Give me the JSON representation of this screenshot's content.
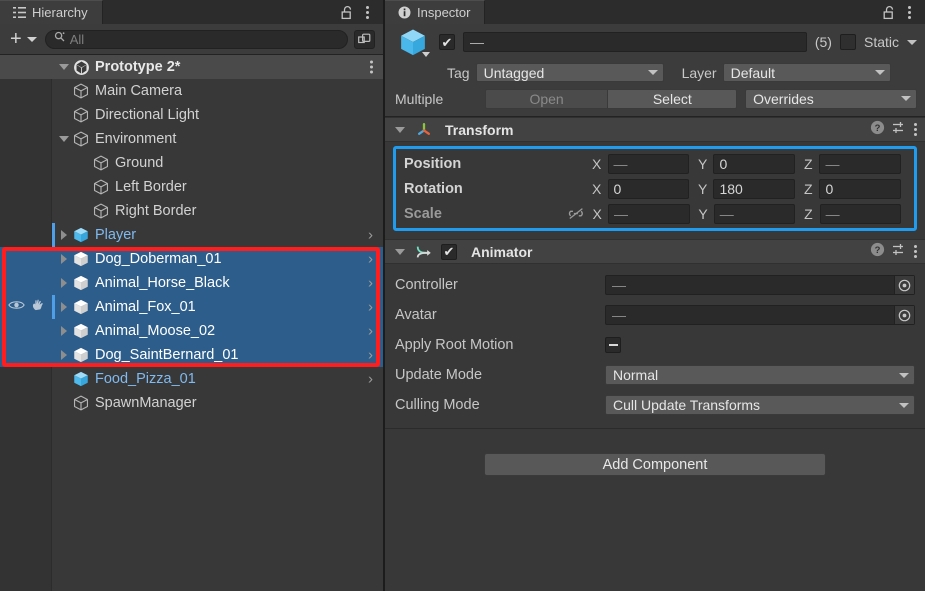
{
  "hierarchy": {
    "tab_label": "Hierarchy",
    "tab_icon": "hierarchy-icon",
    "lock_icon": "lock-open-icon",
    "menu_icon": "kebab-menu-icon",
    "toolbar": {
      "add_label": "+",
      "add_icon": "plus-icon",
      "search_placeholder": "All",
      "search_icon": "search-icon",
      "expand_icon": "external-window-icon"
    },
    "scene": {
      "name": "Prototype 2*",
      "icon": "unity-scene-icon",
      "expanded": true
    },
    "items": [
      {
        "label": "Main Camera",
        "depth": 2,
        "icon": "cube-gray-icon",
        "foldout": "none",
        "selected": false,
        "prefab": false,
        "chevron": false
      },
      {
        "label": "Directional Light",
        "depth": 2,
        "icon": "cube-gray-icon",
        "foldout": "none",
        "selected": false,
        "prefab": false,
        "chevron": false
      },
      {
        "label": "Environment",
        "depth": 2,
        "icon": "cube-gray-icon",
        "foldout": "expanded",
        "selected": false,
        "prefab": false,
        "chevron": false
      },
      {
        "label": "Ground",
        "depth": 3,
        "icon": "cube-gray-icon",
        "foldout": "none",
        "selected": false,
        "prefab": false,
        "chevron": false
      },
      {
        "label": "Left Border",
        "depth": 3,
        "icon": "cube-gray-icon",
        "foldout": "none",
        "selected": false,
        "prefab": false,
        "chevron": false
      },
      {
        "label": "Right Border",
        "depth": 3,
        "icon": "cube-gray-icon",
        "foldout": "none",
        "selected": false,
        "prefab": false,
        "chevron": false
      },
      {
        "label": "Player",
        "depth": 2,
        "icon": "cube-blue-icon",
        "foldout": "collapsed",
        "selected": false,
        "prefab": true,
        "chevron": true,
        "vis_marker": true
      },
      {
        "label": "Dog_Doberman_01",
        "depth": 2,
        "icon": "cube-white-icon",
        "foldout": "collapsed",
        "selected": true,
        "prefab": false,
        "chevron": true
      },
      {
        "label": "Animal_Horse_Black",
        "depth": 2,
        "icon": "cube-white-icon",
        "foldout": "collapsed",
        "selected": true,
        "prefab": false,
        "chevron": true
      },
      {
        "label": "Animal_Fox_01",
        "depth": 2,
        "icon": "cube-white-icon",
        "foldout": "collapsed",
        "selected": true,
        "prefab": false,
        "chevron": true,
        "gutter_icons": true,
        "vis_marker": true
      },
      {
        "label": "Animal_Moose_02",
        "depth": 2,
        "icon": "cube-white-icon",
        "foldout": "collapsed",
        "selected": true,
        "prefab": false,
        "chevron": true
      },
      {
        "label": "Dog_SaintBernard_01",
        "depth": 2,
        "icon": "cube-white-icon",
        "foldout": "collapsed",
        "selected": true,
        "prefab": false,
        "chevron": true
      },
      {
        "label": "Food_Pizza_01",
        "depth": 2,
        "icon": "cube-blue-icon",
        "foldout": "none",
        "selected": false,
        "prefab": true,
        "chevron": true
      },
      {
        "label": "SpawnManager",
        "depth": 2,
        "icon": "cube-gray-icon",
        "foldout": "none",
        "selected": false,
        "prefab": false,
        "chevron": false
      }
    ],
    "gutter": {
      "visibility_icon": "eye-icon",
      "pickability_icon": "hand-pointer-icon"
    },
    "annotation": {
      "color": "#ff1d1d",
      "target": "multi-selected-animal-rows"
    }
  },
  "inspector": {
    "tab_label": "Inspector",
    "tab_icon": "info-icon",
    "lock_icon": "lock-open-icon",
    "menu_icon": "kebab-menu-icon",
    "gameobject": {
      "icon": "cube-blue-icon",
      "enabled": true,
      "name_value": "—",
      "count_label": "(5)",
      "static_label": "Static",
      "static_checked": false,
      "tag_label": "Tag",
      "tag_value": "Untagged",
      "layer_label": "Layer",
      "layer_value": "Default",
      "prefab_label": "Multiple",
      "open_label": "Open",
      "open_disabled": true,
      "select_label": "Select",
      "overrides_label": "Overrides"
    },
    "transform": {
      "title": "Transform",
      "icon": "transform-gizmo-icon",
      "expanded": true,
      "help_icon": "help-circle-icon",
      "preset_icon": "preset-sliders-icon",
      "menu_icon": "kebab-menu-icon",
      "highlight_color": "#1f9cf0",
      "rows": [
        {
          "label": "Position",
          "dim": false,
          "lock_icon": false,
          "fields": [
            {
              "axis": "X",
              "value": "—",
              "empty": true
            },
            {
              "axis": "Y",
              "value": "0",
              "empty": false
            },
            {
              "axis": "Z",
              "value": "—",
              "empty": true
            }
          ]
        },
        {
          "label": "Rotation",
          "dim": false,
          "lock_icon": false,
          "fields": [
            {
              "axis": "X",
              "value": "0",
              "empty": false
            },
            {
              "axis": "Y",
              "value": "180",
              "empty": false
            },
            {
              "axis": "Z",
              "value": "0",
              "empty": false
            }
          ]
        },
        {
          "label": "Scale",
          "dim": true,
          "lock_icon": true,
          "lock_icon_name": "constrain-proportions-off-icon",
          "fields": [
            {
              "axis": "X",
              "value": "—",
              "empty": true
            },
            {
              "axis": "Y",
              "value": "—",
              "empty": true
            },
            {
              "axis": "Z",
              "value": "—",
              "empty": true
            }
          ]
        }
      ]
    },
    "animator": {
      "title": "Animator",
      "icon": "animator-icon",
      "expanded": true,
      "enabled": true,
      "help_icon": "help-circle-icon",
      "preset_icon": "preset-sliders-icon",
      "menu_icon": "kebab-menu-icon",
      "controller_label": "Controller",
      "controller_value": "—",
      "avatar_label": "Avatar",
      "avatar_value": "—",
      "apply_root_motion_label": "Apply Root Motion",
      "apply_root_motion_state": "mixed",
      "update_mode_label": "Update Mode",
      "update_mode_value": "Normal",
      "culling_mode_label": "Culling Mode",
      "culling_mode_value": "Cull Update Transforms",
      "picker_icon": "object-picker-icon"
    },
    "add_component_label": "Add Component"
  }
}
